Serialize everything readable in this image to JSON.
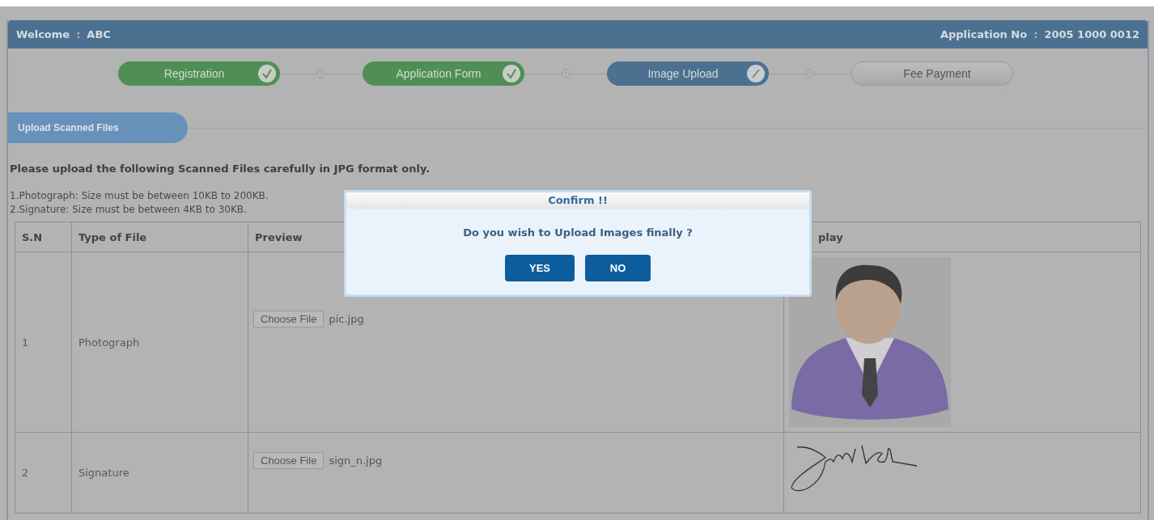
{
  "header": {
    "welcome_label": "Welcome",
    "welcome_sep": ":",
    "user": "ABC",
    "application_label": "Application No",
    "application_sep": ":",
    "application_no": "2005 1000 0012"
  },
  "steps": [
    {
      "label": "Registration",
      "kind": "done"
    },
    {
      "label": "Application Form",
      "kind": "done"
    },
    {
      "label": "Image Upload",
      "kind": "current"
    },
    {
      "label": "Fee Payment",
      "kind": "pending"
    }
  ],
  "section_tab": "Upload Scanned Files",
  "instruction": "Please upload the following Scanned Files carefully in JPG format only.",
  "notes": [
    "1.Photograph: Size must be between 10KB to 200KB.",
    "2.Signature: Size must be between 4KB to 30KB."
  ],
  "table": {
    "columns": [
      "S.N",
      "Type of File",
      "Preview",
      "play"
    ],
    "rows": [
      {
        "sn": "1",
        "type": "Photograph",
        "button": "Choose File",
        "file": "pic.jpg",
        "kind": "avatar"
      },
      {
        "sn": "2",
        "type": "Signature",
        "button": "Choose File",
        "file": "sign_n.jpg",
        "kind": "signature"
      }
    ]
  },
  "dialog": {
    "title": "Confirm !!",
    "message": "Do you wish to Upload Images finally ?",
    "buttons": [
      "YES",
      "NO"
    ]
  }
}
